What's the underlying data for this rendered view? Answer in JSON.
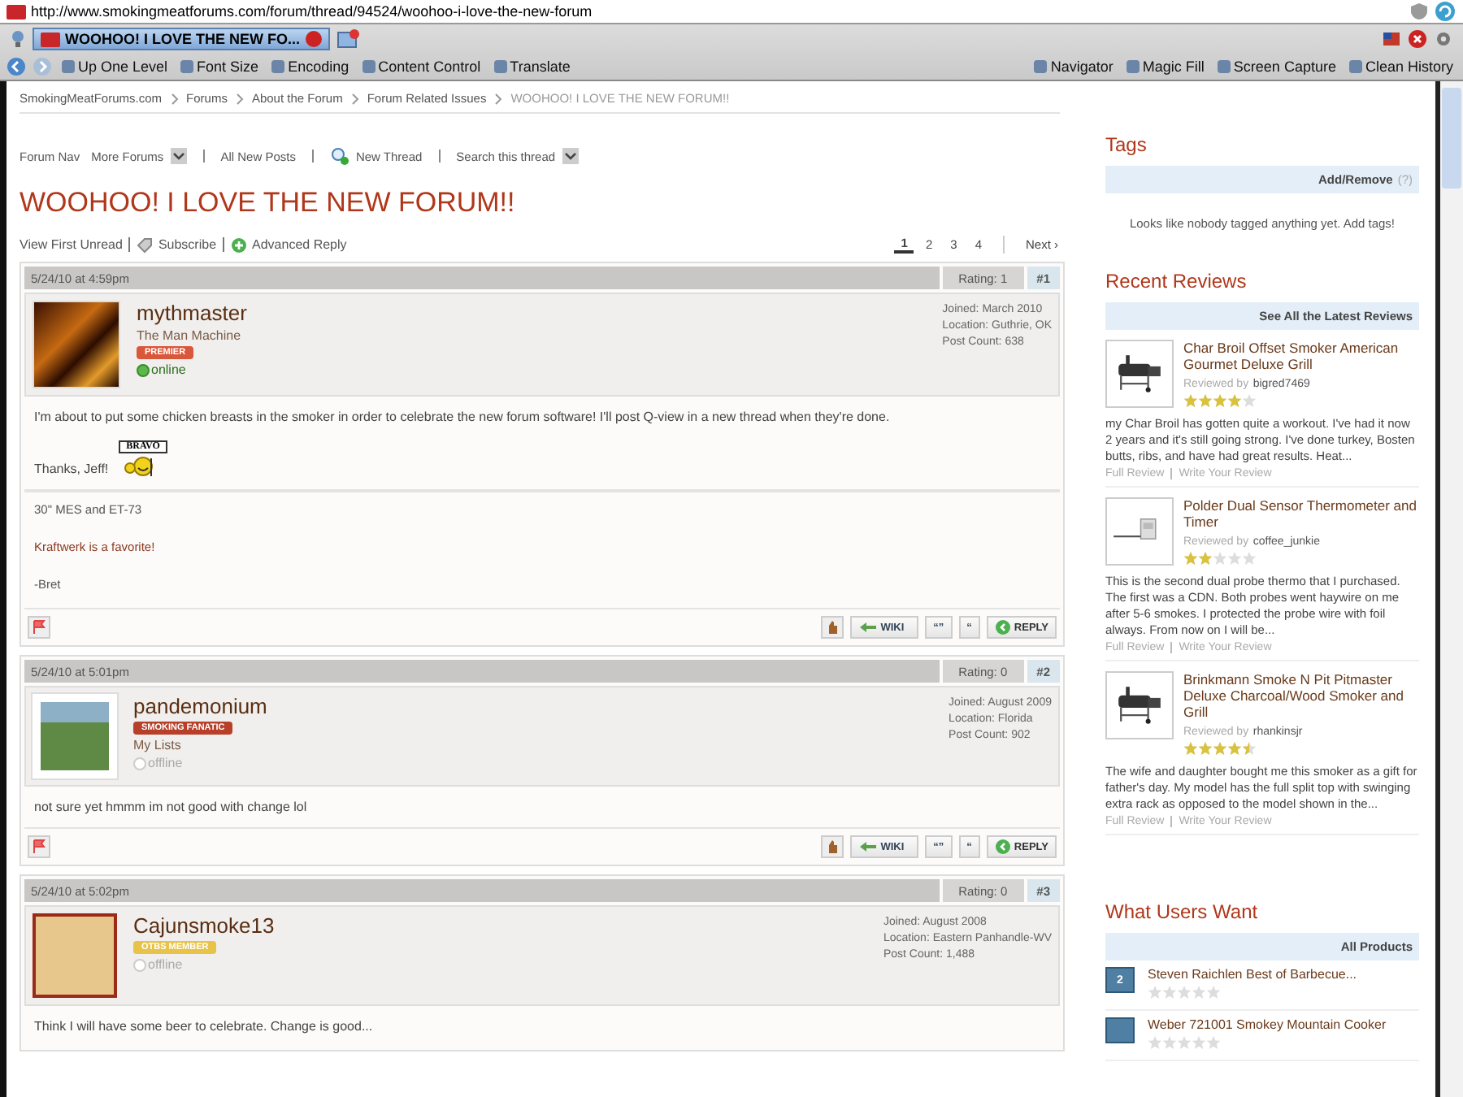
{
  "browser": {
    "url": "http://www.smokingmeatforums.com/forum/thread/94524/woohoo-i-love-the-new-forum",
    "tab_title": "WOOHOO! I LOVE THE NEW FO...",
    "toolbar_left": [
      "Up One Level",
      "Font Size",
      "Encoding",
      "Content Control",
      "Translate"
    ],
    "toolbar_right": [
      "Navigator",
      "Magic Fill",
      "Screen Capture",
      "Clean History"
    ]
  },
  "breadcrumbs": [
    "SmokingMeatForums.com",
    "Forums",
    "About the Forum",
    "Forum Related Issues",
    "WOOHOO! I LOVE THE NEW FORUM!!"
  ],
  "forum_nav": {
    "label": "Forum Nav",
    "items": [
      {
        "text": "More Forums",
        "kind": "dropdown"
      },
      {
        "text": "All New Posts",
        "kind": "link"
      },
      {
        "text": "New Thread",
        "kind": "icon-link"
      },
      {
        "text": "Search this thread",
        "kind": "dropdown"
      }
    ]
  },
  "thread_title": "WOOHOO! I LOVE THE NEW FORUM!!",
  "thread_actions": [
    "View First Unread",
    "Subscribe",
    "Advanced Reply"
  ],
  "pagination": {
    "pages": [
      {
        "label": "1",
        "selected": true
      },
      {
        "label": "2",
        "selected": false
      },
      {
        "label": "3",
        "selected": false
      },
      {
        "label": "4",
        "selected": false
      }
    ],
    "next": "Next ›"
  },
  "posts": [
    {
      "date": "5/24/10 at 4:59pm",
      "rating": "Rating: 1",
      "number": "#1",
      "user": {
        "name": "mythmaster",
        "title": "The Man Machine",
        "badge": {
          "text": "PREMIER",
          "color": "#d9573a"
        },
        "online": true,
        "status": "online"
      },
      "info": [
        "Joined: March 2010",
        "Location: Guthrie, OK",
        "Post Count: 638"
      ],
      "body": [
        "I'm about to put some chicken breasts in the smoker in order to celebrate the new forum software!  I'll post Q-view in a new thread when they're done."
      ],
      "closing": "Thanks, Jeff!",
      "smiley_sign": "BRAVO",
      "signature": [
        "30\" MES and ET-73",
        "Kraftwerk is a favorite!",
        "-Bret"
      ],
      "actions": [
        "WIKI",
        "“”",
        "“",
        "REPLY"
      ]
    },
    {
      "date": "5/24/10 at 5:01pm",
      "rating": "Rating: 0",
      "number": "#2",
      "user": {
        "name": "pandemonium",
        "badge": {
          "text": "SMOKING FANATIC",
          "color": "#b8402a"
        },
        "link": "My Lists",
        "online": false,
        "status": "offline"
      },
      "info": [
        "Joined: August 2009",
        "Location: Florida",
        "Post Count: 902"
      ],
      "body": [
        "not sure yet hmmm  im not good with change lol"
      ],
      "actions": [
        "WIKI",
        "“”",
        "“",
        "REPLY"
      ]
    },
    {
      "date": "5/24/10 at 5:02pm",
      "rating": "Rating: 0",
      "number": "#3",
      "user": {
        "name": "Cajunsmoke13",
        "badge": {
          "text": "OTBS MEMBER",
          "color": "#e8c34a"
        },
        "online": false,
        "status": "offline"
      },
      "info": [
        "Joined: August 2008",
        "Location: Eastern Panhandle-WV",
        "Post Count: 1,488"
      ],
      "body": [
        "Think I will have some beer to celebrate.  Change is good..."
      ]
    }
  ],
  "tags": {
    "title": "Tags",
    "header_link": "Add/Remove",
    "help": "(?)",
    "empty": "Looks like nobody tagged anything yet. Add tags!"
  },
  "reviews": {
    "title": "Recent Reviews",
    "header_link": "See All the Latest Reviews",
    "items": [
      {
        "title": "Char Broil Offset Smoker American Gourmet Deluxe Grill",
        "by": "Reviewed by",
        "reviewer": "bigred7469",
        "stars": 4,
        "excerpt": "my Char Broil has gotten quite a workout.  I've had it now 2 years and it's still going strong. I've done turkey, Bosten butts, ribs, and have had great results. Heat...",
        "links": [
          "Full Review",
          "Write Your Review"
        ],
        "kind": "offset"
      },
      {
        "title": "Polder Dual Sensor Thermometer and Timer",
        "by": "Reviewed by",
        "reviewer": "coffee_junkie",
        "stars": 2,
        "excerpt": "This is the second dual probe thermo that I purchased. The first was a CDN. Both probes went haywire on me after 5-6 smokes. I protected the probe wire with foil always. From now on I will be...",
        "links": [
          "Full Review",
          "Write Your Review"
        ],
        "kind": "thermo"
      },
      {
        "title": "Brinkmann Smoke N Pit Pitmaster Deluxe Charcoal/Wood Smoker and Grill",
        "by": "Reviewed by",
        "reviewer": "rhankinsjr",
        "stars": 4.5,
        "excerpt": "The wife and daughter bought me this smoker as a gift for father's day.   My model has the full split top with swinging extra rack as opposed to the model shown in the...",
        "links": [
          "Full Review",
          "Write Your Review"
        ],
        "kind": "offset"
      }
    ]
  },
  "wants": {
    "title": "What Users Want",
    "header_link": "All Products",
    "items": [
      {
        "rank": "2",
        "name": "Steven Raichlen Best of Barbecue...",
        "stars": 0
      },
      {
        "name": "Weber 721001 Smokey Mountain Cooker",
        "stars": 0
      }
    ]
  }
}
